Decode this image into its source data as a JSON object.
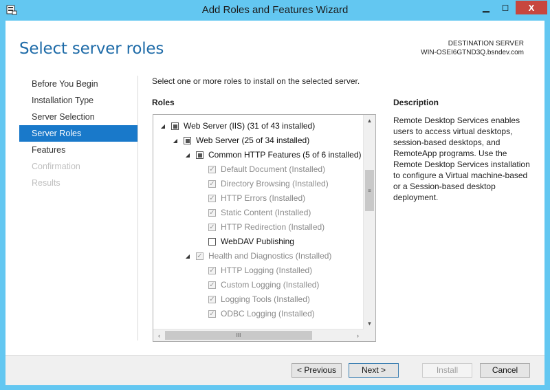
{
  "window": {
    "title": "Add Roles and Features Wizard",
    "close_glyph": "X"
  },
  "header": {
    "page_title": "Select server roles",
    "dest_label": "DESTINATION SERVER",
    "dest_server": "WIN-OSEI6GTND3Q.bsndev.com"
  },
  "nav": {
    "items": [
      {
        "label": "Before You Begin",
        "state": "normal"
      },
      {
        "label": "Installation Type",
        "state": "normal"
      },
      {
        "label": "Server Selection",
        "state": "normal"
      },
      {
        "label": "Server Roles",
        "state": "selected"
      },
      {
        "label": "Features",
        "state": "normal"
      },
      {
        "label": "Confirmation",
        "state": "disabled"
      },
      {
        "label": "Results",
        "state": "disabled"
      }
    ]
  },
  "main": {
    "instruction": "Select one or more roles to install on the selected server.",
    "roles_label": "Roles",
    "tree": [
      {
        "label": "Web Server (IIS) (31 of 43 installed)",
        "level": 0,
        "expander": "◢",
        "check": "partial",
        "grey": false
      },
      {
        "label": "Web Server (25 of 34 installed)",
        "level": 1,
        "expander": "◢",
        "check": "partial",
        "grey": false
      },
      {
        "label": "Common HTTP Features (5 of 6 installed)",
        "level": 2,
        "expander": "◢",
        "check": "partial",
        "grey": false
      },
      {
        "label": "Default Document (Installed)",
        "level": 3,
        "expander": "",
        "check": "checked",
        "grey": true
      },
      {
        "label": "Directory Browsing (Installed)",
        "level": 3,
        "expander": "",
        "check": "checked",
        "grey": true
      },
      {
        "label": "HTTP Errors (Installed)",
        "level": 3,
        "expander": "",
        "check": "checked",
        "grey": true
      },
      {
        "label": "Static Content (Installed)",
        "level": 3,
        "expander": "",
        "check": "checked",
        "grey": true
      },
      {
        "label": "HTTP Redirection (Installed)",
        "level": 3,
        "expander": "",
        "check": "checked",
        "grey": true
      },
      {
        "label": "WebDAV Publishing",
        "level": 3,
        "expander": "",
        "check": "unchecked",
        "grey": false
      },
      {
        "label": "Health and Diagnostics (Installed)",
        "level": 2,
        "expander": "◢",
        "check": "checked",
        "grey": true
      },
      {
        "label": "HTTP Logging (Installed)",
        "level": 3,
        "expander": "",
        "check": "checked",
        "grey": true
      },
      {
        "label": "Custom Logging (Installed)",
        "level": 3,
        "expander": "",
        "check": "checked",
        "grey": true
      },
      {
        "label": "Logging Tools (Installed)",
        "level": 3,
        "expander": "",
        "check": "checked",
        "grey": true
      },
      {
        "label": "ODBC Logging (Installed)",
        "level": 3,
        "expander": "",
        "check": "checked",
        "grey": true
      }
    ],
    "description_label": "Description",
    "description_text": "Remote Desktop Services enables users to access virtual desktops, session-based desktops, and RemoteApp programs. Use the Remote Desktop Services installation to configure a Virtual machine-based or a Session-based desktop deployment."
  },
  "footer": {
    "previous": "< Previous",
    "next": "Next >",
    "install": "Install",
    "cancel": "Cancel"
  }
}
